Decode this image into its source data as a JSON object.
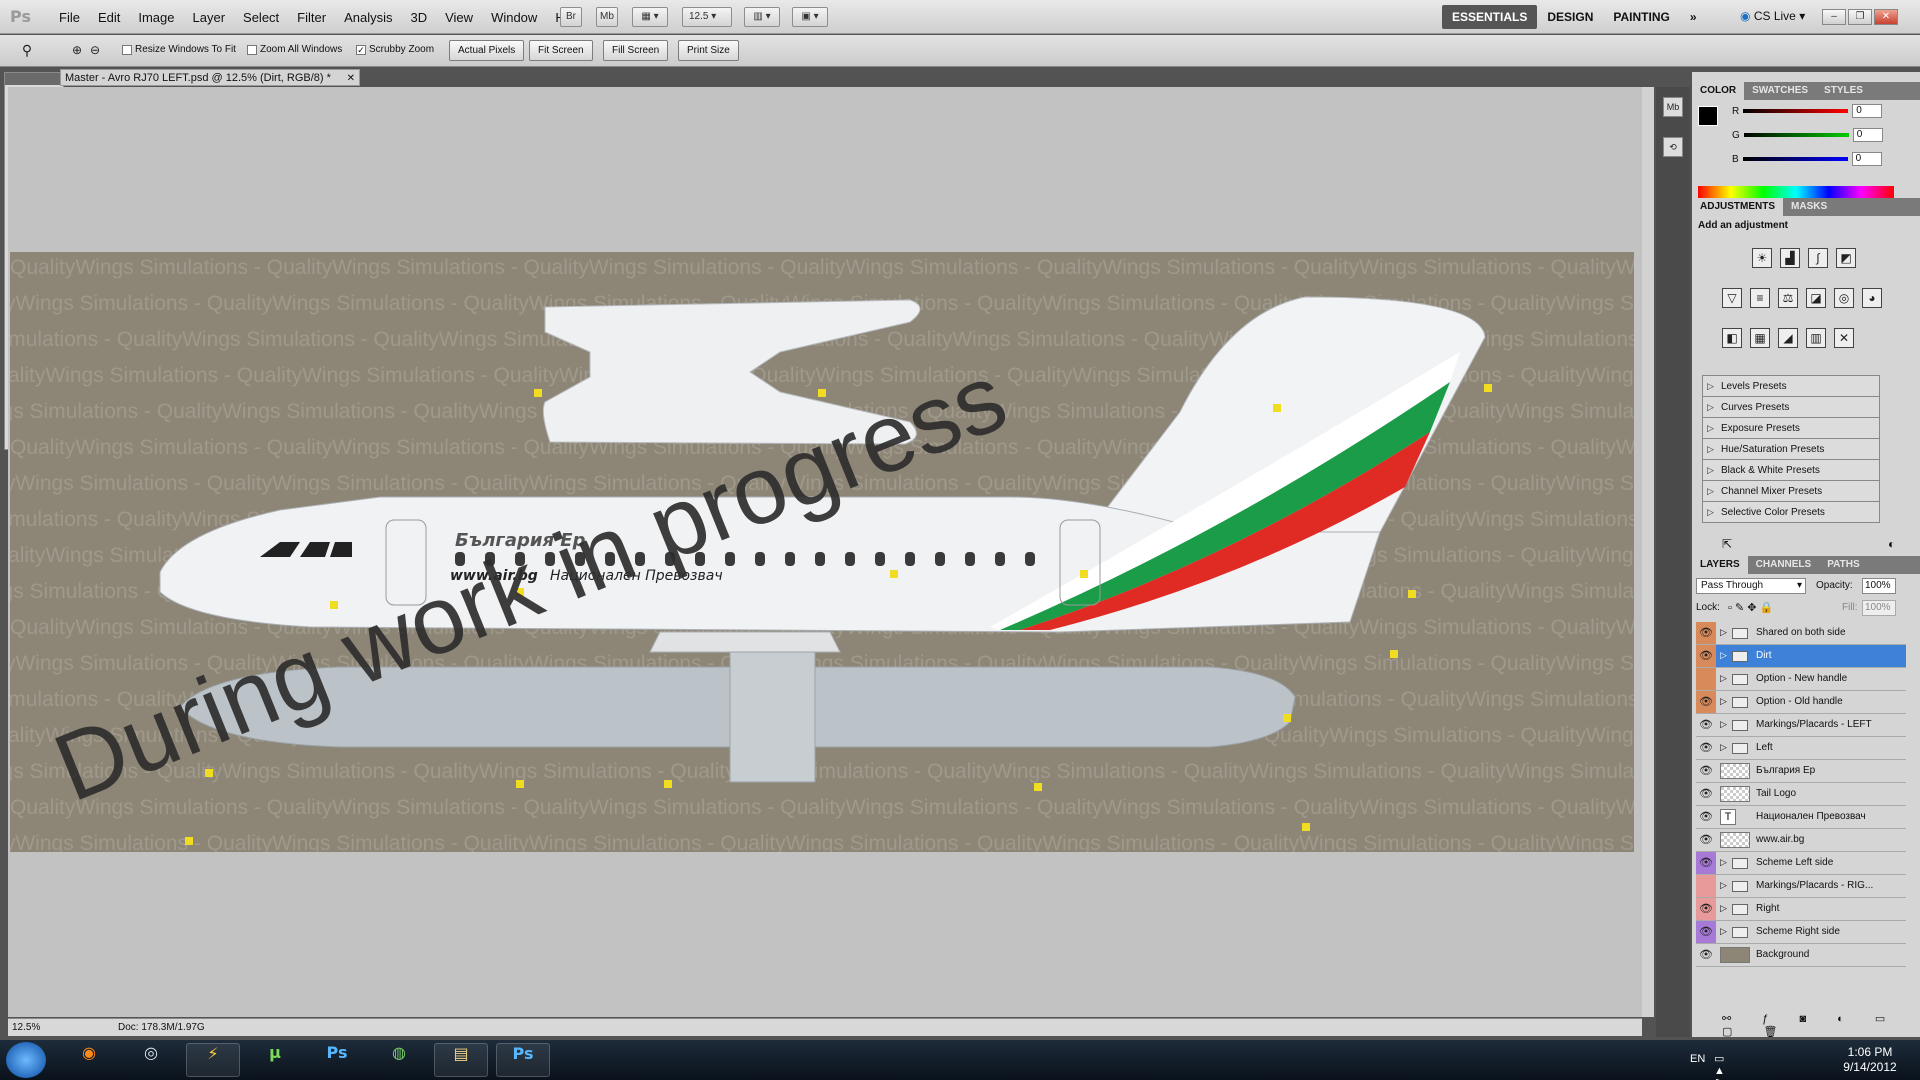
{
  "menubar": {
    "logo": "Ps",
    "menus": [
      "File",
      "Edit",
      "Image",
      "Layer",
      "Select",
      "Filter",
      "Analysis",
      "3D",
      "View",
      "Window",
      "Help"
    ],
    "br_label": "Br",
    "mb_label": "Mb",
    "zoom_value": "12.5",
    "workspaces": [
      "ESSENTIALS",
      "DESIGN",
      "PAINTING"
    ],
    "workspace_more": "»",
    "cs_live": "CS Live"
  },
  "options": {
    "resize_windows": "Resize Windows To Fit",
    "zoom_all_windows": "Zoom All Windows",
    "scrubby_zoom": "Scrubby Zoom",
    "actual_pixels": "Actual Pixels",
    "fit_screen": "Fit Screen",
    "fill_screen": "Fill Screen",
    "print_size": "Print Size"
  },
  "document": {
    "tab_title": "Master - Avro RJ70 LEFT.psd @ 12.5% (Dirt, RGB/8) *",
    "watermark_text": "QualityWings Simulations - QualityWings Simulations - QualityWings Simulations - QualityWings Simulations - QualityWings Simulations - QualityWings Simulations - QualityWings Simulations -",
    "overlay_text": "During work in progress",
    "livery_title": "България Ер",
    "livery_url": "www.air.bg",
    "livery_slogan": "Национален Превозвач",
    "status_zoom": "12.5%",
    "status_info": "Doc: 178.3M/1.97G"
  },
  "color_panel": {
    "tabs": [
      "COLOR",
      "SWATCHES",
      "STYLES"
    ],
    "channels": [
      {
        "label": "R",
        "value": "0"
      },
      {
        "label": "G",
        "value": "0"
      },
      {
        "label": "B",
        "value": "0"
      }
    ]
  },
  "adjustments_panel": {
    "tabs": [
      "ADJUSTMENTS",
      "MASKS"
    ],
    "heading": "Add an adjustment",
    "presets": [
      "Levels Presets",
      "Curves Presets",
      "Exposure Presets",
      "Hue/Saturation Presets",
      "Black & White Presets",
      "Channel Mixer Presets",
      "Selective Color Presets"
    ]
  },
  "layers_panel": {
    "tabs": [
      "LAYERS",
      "CHANNELS",
      "PATHS"
    ],
    "blend_mode": "Pass Through",
    "opacity_label": "Opacity:",
    "opacity_value": "100%",
    "lock_label": "Lock:",
    "fill_label": "Fill:",
    "fill_value": "100%",
    "layers": [
      {
        "name": "Shared on both side",
        "kind": "group",
        "eye_color": "#d88a5a",
        "selected": false
      },
      {
        "name": "Dirt",
        "kind": "group",
        "eye_color": "#d88a5a",
        "selected": true
      },
      {
        "name": "Option - New handle",
        "kind": "group",
        "eye_color": "#d88a5a",
        "selected": false,
        "hidden": true
      },
      {
        "name": "Option - Old handle",
        "kind": "group",
        "eye_color": "#d88a5a",
        "selected": false
      },
      {
        "name": "Markings/Placards - LEFT",
        "kind": "group",
        "eye_color": "",
        "selected": false
      },
      {
        "name": "Left",
        "kind": "group",
        "eye_color": "",
        "selected": false
      },
      {
        "name": "България Ер",
        "kind": "raster",
        "eye_color": "",
        "selected": false
      },
      {
        "name": "Tail Logo",
        "kind": "raster",
        "eye_color": "",
        "selected": false
      },
      {
        "name": "Национален  Превозвач",
        "kind": "text",
        "eye_color": "",
        "selected": false
      },
      {
        "name": "www.air.bg",
        "kind": "raster",
        "eye_color": "",
        "selected": false
      },
      {
        "name": "Scheme Left side",
        "kind": "group",
        "eye_color": "#a87ad8",
        "selected": false
      },
      {
        "name": "Markings/Placards - RIG...",
        "kind": "group",
        "eye_color": "#e89a9a",
        "selected": false,
        "hidden": true
      },
      {
        "name": "Right",
        "kind": "group",
        "eye_color": "#e89a9a",
        "selected": false
      },
      {
        "name": "Scheme Right side",
        "kind": "group",
        "eye_color": "#a87ad8",
        "selected": false
      },
      {
        "name": "Background",
        "kind": "background",
        "eye_color": "",
        "selected": false
      }
    ]
  },
  "taskbar": {
    "apps": [
      "Firefox",
      "MVP",
      "Winamp",
      "uTorrent",
      "Photoshop",
      "Chrome",
      "Explorer",
      "Photoshop"
    ],
    "app_glyphs": [
      "◉",
      "◎",
      "⚡",
      "µ",
      "Ps",
      "◍",
      "▤",
      "Ps"
    ],
    "language": "EN",
    "time": "1:06 PM",
    "date": "9/14/2012"
  },
  "colors": {
    "selection": "#3d82d8",
    "canvas_bg": "#8d8677",
    "flag_white": "#ffffff",
    "flag_green": "#1a9c48",
    "flag_red": "#e02a24"
  }
}
